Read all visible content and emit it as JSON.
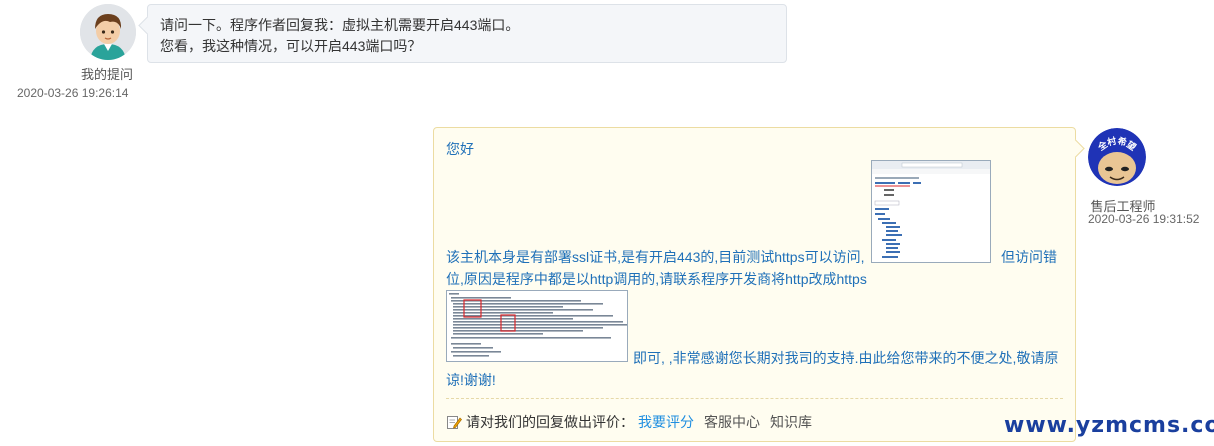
{
  "question": {
    "user_name": "我的提问",
    "time": "2020-03-26 19:26:14",
    "lines": [
      "请问一下。程序作者回复我：虚拟主机需要开启443端口。",
      "您看，我这种情况，可以开启443端口吗？"
    ]
  },
  "answer": {
    "user_name": "售后工程师",
    "avatar_text": "全村希望",
    "time": "2020-03-26 19:31:52",
    "greeting": "您好",
    "para1_a": "该主机本身是有部署ssl证书,是有开启443的,目前测试https可以访问,",
    "para1_b": "但访问错",
    "para1_c": "位,原因是程序中都是以http调用的,请联系程序开发商将http改成https",
    "para2_a": "即可, ,非常感谢您长期对我司的支持.由此给您带来的不便之处,敬请原",
    "para2_b": "谅!谢谢!",
    "rating_prompt": "请对我们的回复做出评价：",
    "rate_link": "我要评分",
    "service_link": "客服中心",
    "kb_link": "知识库"
  },
  "watermark": "www.yzmcms.com",
  "icons": [
    "user-avatar-icon",
    "engineer-avatar-icon",
    "edit-icon"
  ],
  "colors": {
    "link": "#1f70b8",
    "accent_link": "#1f8ee0",
    "watermark": "#1a3f9e"
  }
}
